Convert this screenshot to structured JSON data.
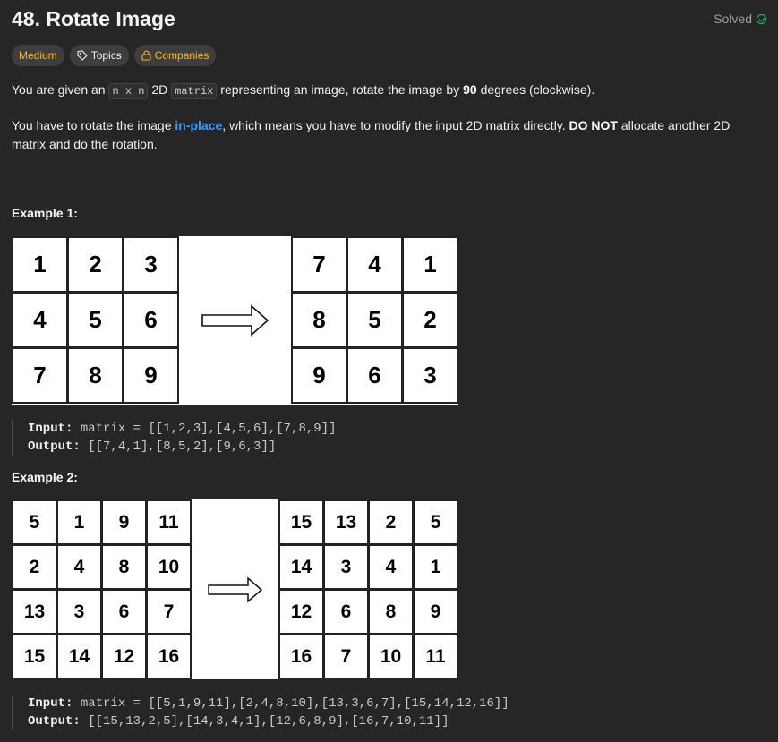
{
  "problem": {
    "title": "48. Rotate Image",
    "status": "Solved",
    "difficulty": "Medium",
    "topics_label": "Topics",
    "companies_label": "Companies"
  },
  "description": {
    "p1_a": "You are given an ",
    "p1_code1": "n x n",
    "p1_b": " 2D ",
    "p1_code2": "matrix",
    "p1_c": " representing an image, rotate the image by ",
    "p1_bold": "90",
    "p1_d": " degrees (clockwise).",
    "p2_a": "You have to rotate the image ",
    "p2_link": "in-place",
    "p2_b": ", which means you have to modify the input 2D matrix directly. ",
    "p2_bold": "DO NOT",
    "p2_c": " allocate another 2D matrix and do the rotation."
  },
  "examples": [
    {
      "heading": "Example 1:",
      "input_grid": [
        [
          1,
          2,
          3
        ],
        [
          4,
          5,
          6
        ],
        [
          7,
          8,
          9
        ]
      ],
      "output_grid": [
        [
          7,
          4,
          1
        ],
        [
          8,
          5,
          2
        ],
        [
          9,
          6,
          3
        ]
      ],
      "input_label": "Input:",
      "input_value": "matrix = [[1,2,3],[4,5,6],[7,8,9]]",
      "output_label": "Output:",
      "output_value": "[[7,4,1],[8,5,2],[9,6,3]]"
    },
    {
      "heading": "Example 2:",
      "input_grid": [
        [
          5,
          1,
          9,
          11
        ],
        [
          2,
          4,
          8,
          10
        ],
        [
          13,
          3,
          6,
          7
        ],
        [
          15,
          14,
          12,
          16
        ]
      ],
      "output_grid": [
        [
          15,
          13,
          2,
          5
        ],
        [
          14,
          3,
          4,
          1
        ],
        [
          12,
          6,
          8,
          9
        ],
        [
          16,
          7,
          10,
          11
        ]
      ],
      "input_label": "Input:",
      "input_value": "matrix = [[5,1,9,11],[2,4,8,10],[13,3,6,7],[15,14,12,16]]",
      "output_label": "Output:",
      "output_value": "[[15,13,2,5],[14,3,4,1],[12,6,8,9],[16,7,10,11]]"
    }
  ],
  "icons": {
    "solved": "check-circle-icon",
    "topics": "tag-icon",
    "companies": "lock-icon",
    "arrow": "right-arrow-icon"
  },
  "colors": {
    "background": "#262626",
    "difficulty_medium": "#ffb800",
    "solved": "#2cbb5d",
    "link": "#3d9bff"
  }
}
